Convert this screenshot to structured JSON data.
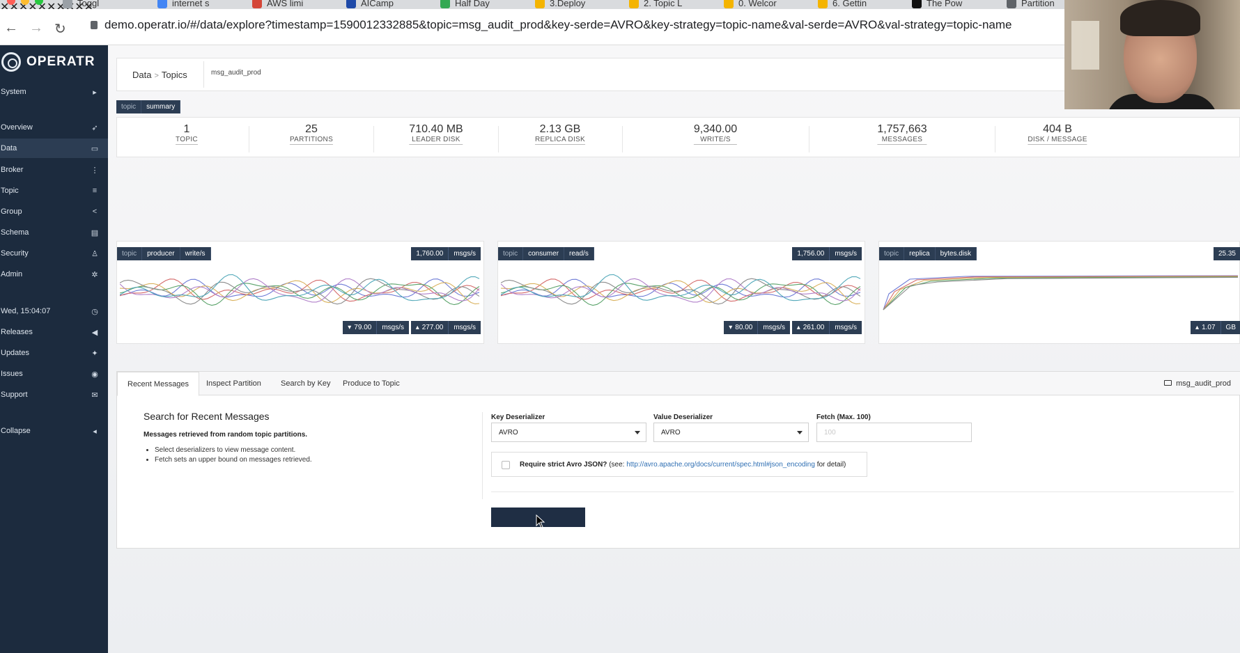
{
  "browser": {
    "tabs": [
      {
        "label": "Toggl",
        "color": "#9aa0a6"
      },
      {
        "label": "internet s",
        "color": "#4285f4"
      },
      {
        "label": "AWS limi",
        "color": "#d44638"
      },
      {
        "label": "AICamp",
        "color": "#1f4aa8"
      },
      {
        "label": "Half Day",
        "color": "#34a853"
      },
      {
        "label": "3.Deploy",
        "color": "#f4b400"
      },
      {
        "label": "2. Topic L",
        "color": "#f4b400"
      },
      {
        "label": "0. Welcor",
        "color": "#f4b400"
      },
      {
        "label": "6. Gettin",
        "color": "#f4b400"
      },
      {
        "label": "The Pow",
        "color": "#111111"
      },
      {
        "label": "Partition",
        "color": "#5f6368"
      }
    ],
    "close_glyph": "✕",
    "url": "demo.operatr.io/#/data/explore?timestamp=1590012332885&topic=msg_audit_prod&key-serde=AVRO&key-strategy=topic-name&val-serde=AVRO&val-strategy=topic-name"
  },
  "sidebar": {
    "brand": "OPERATR",
    "items": [
      {
        "label": "System",
        "icon": "▸"
      },
      {
        "label": "Overview",
        "icon": "➶"
      },
      {
        "label": "Data",
        "icon": "▭"
      },
      {
        "label": "Broker",
        "icon": "⋮"
      },
      {
        "label": "Topic",
        "icon": "≡"
      },
      {
        "label": "Group",
        "icon": "<"
      },
      {
        "label": "Schema",
        "icon": "▤"
      },
      {
        "label": "Security",
        "icon": "♙"
      },
      {
        "label": "Admin",
        "icon": "✲"
      },
      {
        "label": "Wed, 15:04:07",
        "icon": "◷"
      },
      {
        "label": "Releases",
        "icon": "◀"
      },
      {
        "label": "Updates",
        "icon": "✦"
      },
      {
        "label": "Issues",
        "icon": "◉"
      },
      {
        "label": "Support",
        "icon": "✉"
      },
      {
        "label": "Collapse",
        "icon": "◂"
      }
    ]
  },
  "header": {
    "breadcrumb": [
      "Data",
      "Topics"
    ],
    "breadcrumb_sep": ">",
    "search_value": "msg_audit_prod"
  },
  "summary": {
    "badges": [
      "topic",
      "summary"
    ],
    "stats": [
      {
        "value": "1",
        "label": "TOPIC"
      },
      {
        "value": "25",
        "label": "PARTITIONS"
      },
      {
        "value": "710.40 MB",
        "label": "LEADER DISK"
      },
      {
        "value": "2.13 GB",
        "label": "REPLICA DISK"
      },
      {
        "value": "9,340.00",
        "label": "WRITE/S"
      },
      {
        "value": "1,757,663",
        "label": "MESSAGES"
      },
      {
        "value": "404 B",
        "label": "DISK / MESSAGE"
      }
    ]
  },
  "charts": [
    {
      "badges": [
        "topic",
        "producer",
        "write/s"
      ],
      "current": "1,760.00",
      "current_unit": "msgs/s",
      "min": "79.00",
      "min_unit": "msgs/s",
      "max": "277.00",
      "max_unit": "msgs/s",
      "min_arrow": "▾",
      "max_arrow": "▴"
    },
    {
      "badges": [
        "topic",
        "consumer",
        "read/s"
      ],
      "current": "1,756.00",
      "current_unit": "msgs/s",
      "min": "80.00",
      "min_unit": "msgs/s",
      "max": "261.00",
      "max_unit": "msgs/s",
      "min_arrow": "▾",
      "max_arrow": "▴"
    },
    {
      "badges": [
        "topic",
        "replica",
        "bytes.disk"
      ],
      "current": "25.35",
      "current_unit": "",
      "max": "1.07",
      "max_unit": "GB",
      "max_arrow": "▴"
    }
  ],
  "panel": {
    "tabs": [
      "Recent Messages",
      "Inspect Partition",
      "Search by Key",
      "Produce to Topic"
    ],
    "topic": "msg_audit_prod",
    "title": "Search for Recent Messages",
    "subtitle": "Messages retrieved from random topic partitions.",
    "bullets": [
      "Select deserializers to view message content.",
      "Fetch sets an upper bound on messages retrieved."
    ],
    "key_label": "Key Deserializer",
    "key_value": "AVRO",
    "value_label": "Value Deserializer",
    "value_value": "AVRO",
    "fetch_label": "Fetch (Max. 100)",
    "fetch_placeholder": "100",
    "strict_label": "Require strict Avro JSON?",
    "strict_see": "(see:",
    "strict_link": "http://avro.apache.org/docs/current/spec.html#json_encoding",
    "strict_tail": "for detail)"
  }
}
